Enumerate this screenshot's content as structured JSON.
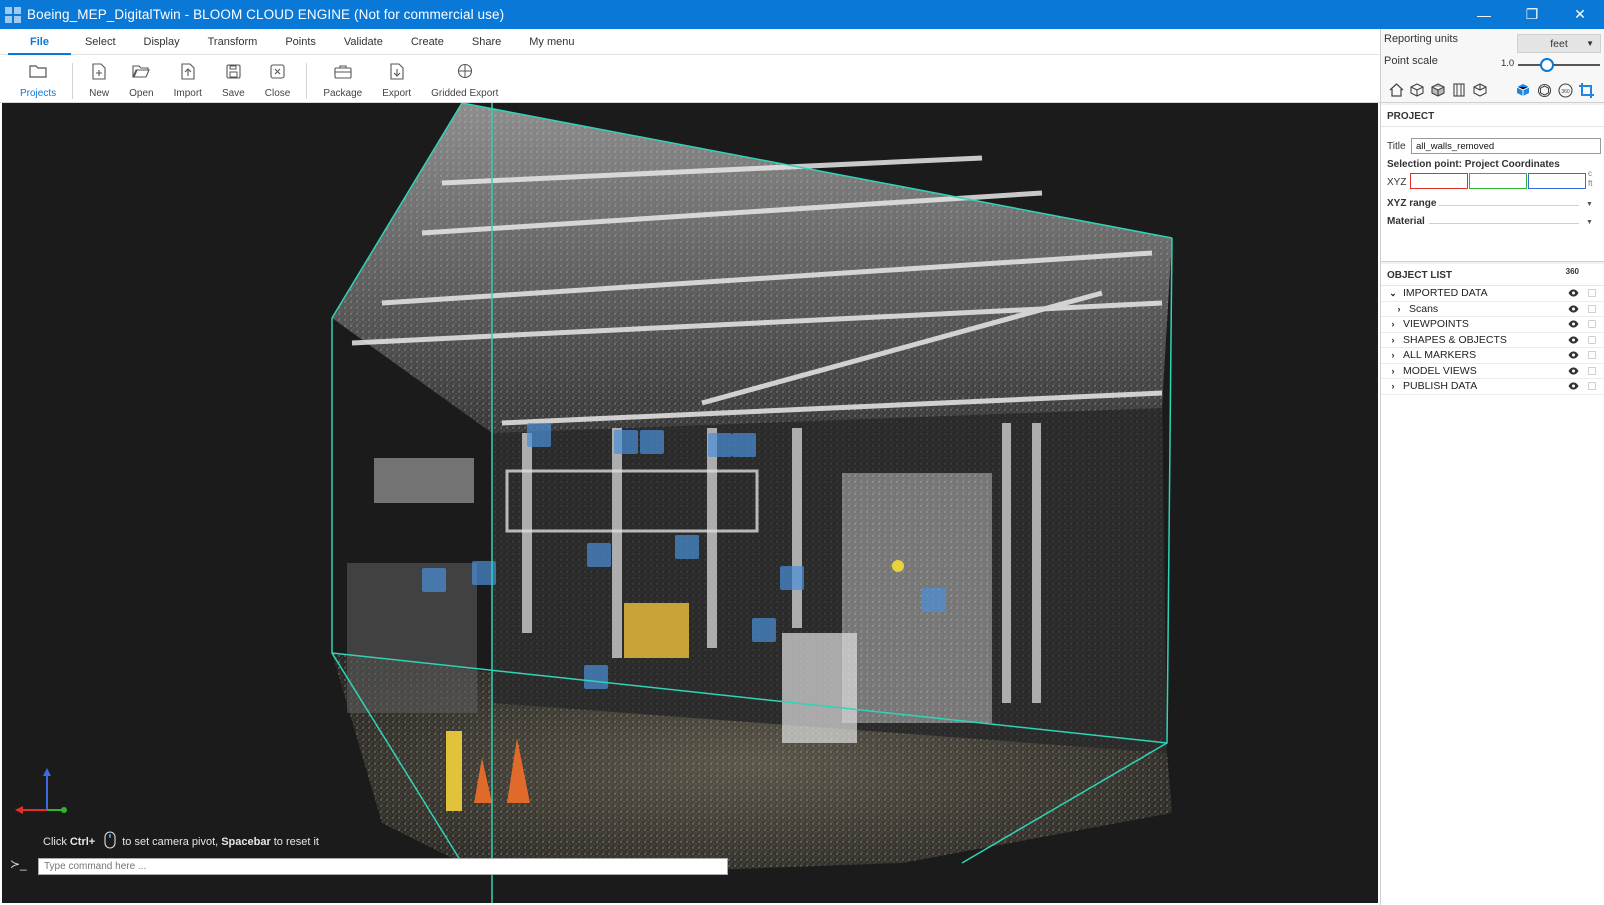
{
  "window": {
    "title": "Boeing_MEP_DigitalTwin - BLOOM CLOUD ENGINE (Not for commercial use)",
    "controls": [
      "—",
      "❐",
      "✕"
    ]
  },
  "menu": [
    "File",
    "Select",
    "Display",
    "Transform",
    "Points",
    "Validate",
    "Create",
    "Share",
    "My menu"
  ],
  "toolbar": {
    "projects": "Projects",
    "new": "New",
    "open": "Open",
    "import": "Import",
    "save": "Save",
    "close": "Close",
    "package": "Package",
    "export": "Export",
    "gridded_export": "Gridded Export"
  },
  "settings": {
    "reporting_units_label": "Reporting units",
    "reporting_units_value": "feet",
    "point_scale_label": "Point scale",
    "point_scale_value": "1.0",
    "point_scale_fraction": 0.35
  },
  "project": {
    "header": "PROJECT",
    "title_label": "Title",
    "title_value": "all_walls_removed",
    "selection_label": "Selection point: Project Coordinates",
    "xyz_label": "XYZ",
    "unit_c": "c",
    "unit_ft": "ft",
    "xyz_range_label": "XYZ range",
    "material_label": "Material"
  },
  "object_list": {
    "header": "OBJECT LIST",
    "icon360": "360",
    "items": [
      {
        "label": "IMPORTED DATA",
        "expanded": true
      },
      {
        "label": "Scans",
        "child": true
      },
      {
        "label": "VIEWPOINTS"
      },
      {
        "label": "SHAPES & OBJECTS"
      },
      {
        "label": "ALL MARKERS"
      },
      {
        "label": "MODEL VIEWS"
      },
      {
        "label": "PUBLISH DATA"
      }
    ]
  },
  "viewport": {
    "hint_click": "Click",
    "hint_ctrl": "Ctrl+",
    "hint_middle": "to set camera pivot,",
    "hint_space": "Spacebar",
    "hint_end": "to reset it",
    "command_prompt": "≻_",
    "command_placeholder": "Type command here ..."
  },
  "colors": {
    "accent": "#0a78d7",
    "bbox": "#2fd4b5",
    "x_axis": "#e0302a",
    "y_axis": "#2fb52f",
    "z_axis": "#3a6be0"
  }
}
